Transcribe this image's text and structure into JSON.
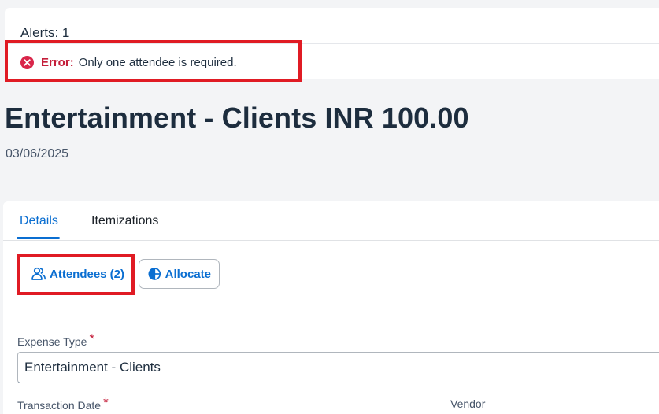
{
  "alerts": {
    "header": "Alerts: 1",
    "error_label": "Error:",
    "error_message": "Only one attendee is required."
  },
  "expense": {
    "title": "Entertainment - Clients INR 100.00",
    "date": "03/06/2025"
  },
  "tabs": [
    {
      "label": "Details",
      "active": true
    },
    {
      "label": "Itemizations",
      "active": false
    }
  ],
  "actions": {
    "attendees_label": "Attendees (2)",
    "allocate_label": "Allocate"
  },
  "form": {
    "expense_type_label": "Expense Type",
    "expense_type_value": "Entertainment - Clients",
    "transaction_date_label": "Transaction Date",
    "vendor_label": "Vendor",
    "required_marker": "*"
  },
  "colors": {
    "accent": "#0a6ed1",
    "error": "#c41e3a",
    "highlight": "#e01b24"
  }
}
